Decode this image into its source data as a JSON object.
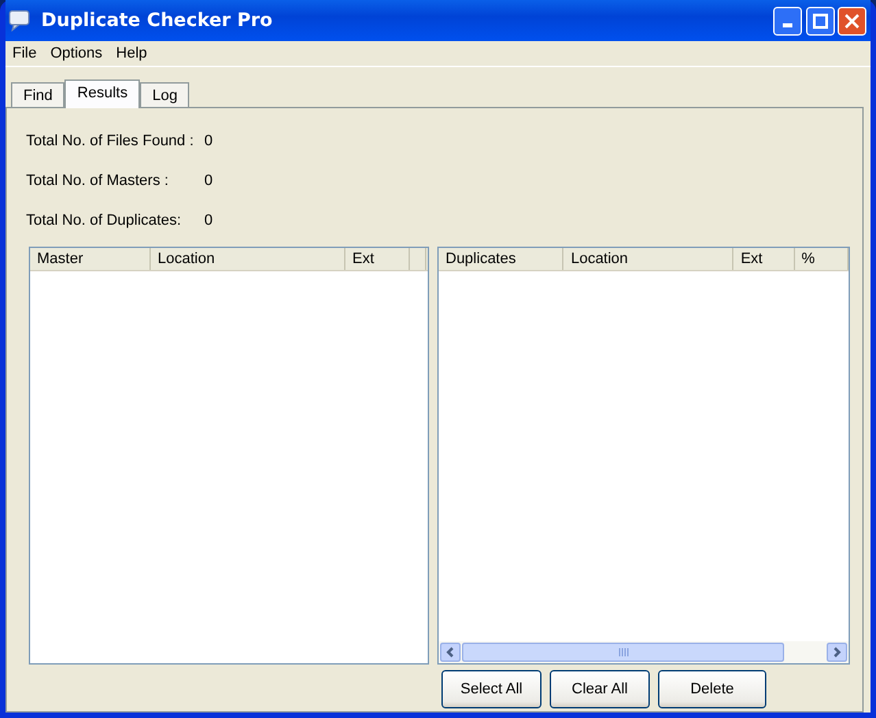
{
  "window": {
    "title": "Duplicate Checker Pro"
  },
  "menu": [
    "File",
    "Options",
    "Help"
  ],
  "tabs": [
    {
      "label": "Find",
      "selected": false
    },
    {
      "label": "Results",
      "selected": true
    },
    {
      "label": "Log",
      "selected": false
    }
  ],
  "stats": [
    {
      "label": "Total No. of Files Found :",
      "value": "0"
    },
    {
      "label": "Total No. of Masters :",
      "value": "0"
    },
    {
      "label": "Total No. of Duplicates:",
      "value": "0"
    }
  ],
  "masters_list": {
    "columns": [
      "Master",
      "Location",
      "Ext",
      ""
    ]
  },
  "duplicates_list": {
    "columns": [
      "Duplicates",
      "Location",
      "Ext",
      "%"
    ]
  },
  "buttons": [
    "Select All",
    "Clear All",
    "Delete"
  ]
}
